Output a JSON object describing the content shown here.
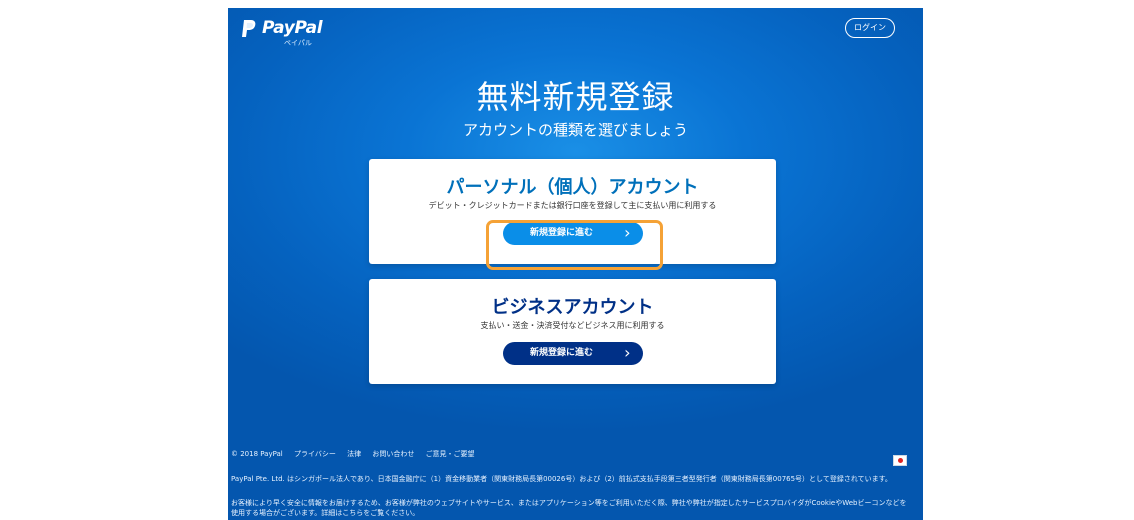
{
  "header": {
    "brand": "PayPal",
    "brand_sub": "ペイパル",
    "login_label": "ログイン"
  },
  "main": {
    "title": "無料新規登録",
    "subtitle": "アカウントの種類を選びましょう"
  },
  "cards": [
    {
      "title": "パーソナル（個人）アカウント",
      "description": "デビット・クレジットカードまたは銀行口座を登録して主に支払い用に利用する",
      "button_label": "新規登録に進む",
      "button_color": "#0a8ee8",
      "highlighted": true
    },
    {
      "title": "ビジネスアカウント",
      "description": "支払い・送金・決済受付などビジネス用に利用する",
      "button_label": "新規登録に進む",
      "button_color": "#003087",
      "highlighted": false
    }
  ],
  "footer": {
    "links": [
      "© 2018 PayPal",
      "プライバシー",
      "法律",
      "お問い合わせ",
      "ご意見・ご要望"
    ],
    "legal": "PayPal Pte. Ltd. はシンガポール法人であり、日本国金融庁に（1）資金移動業者（関東財務局長第00026号）および（2）前払式支払手段第三者型発行者（関東財務局長第00765号）として登録されています。",
    "cookie": "お客様により早く安全に情報をお届けするため、お客様が弊社のウェブサイトやサービス、またはアプリケーション等をご利用いただく際、弊社や弊社が指定したサービスプロバイダがCookieやWebビーコンなどを使用する場合がございます。詳細はこちらをご覧ください。",
    "flag": "japan-flag-icon"
  },
  "colors": {
    "background": "#0562bf",
    "highlight": "#f5a236",
    "personal_title": "#0070ba",
    "business_title": "#003087"
  }
}
